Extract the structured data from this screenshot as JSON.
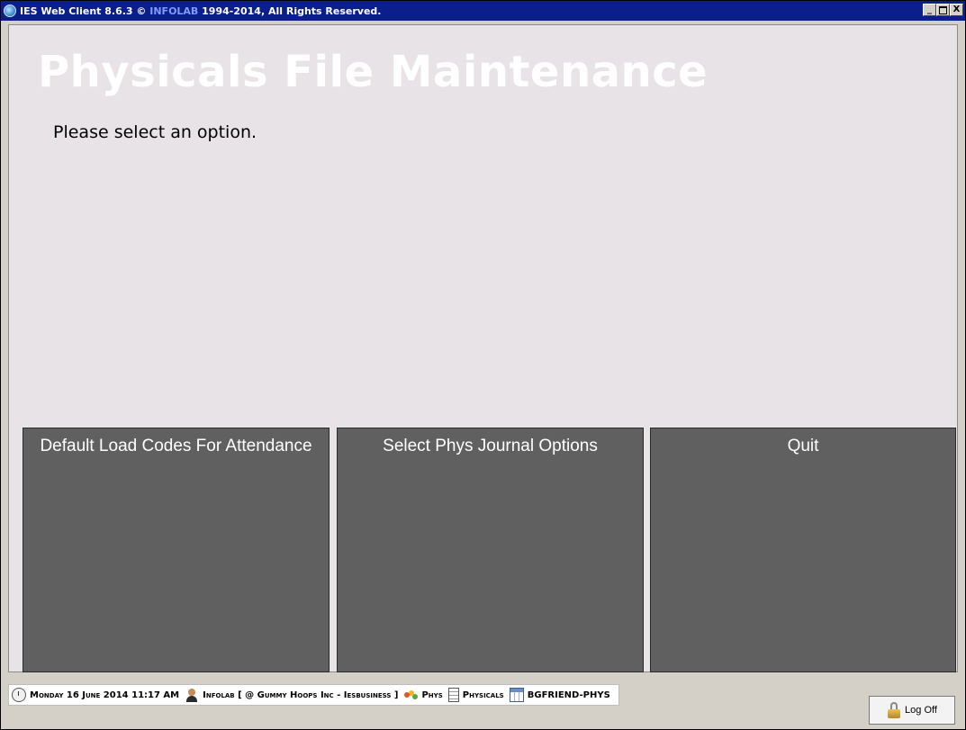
{
  "window": {
    "title_prefix": "IES Web Client 8.6.3 © ",
    "title_brand": "INFOLAB",
    "title_suffix": " 1994-2014, All Rights Reserved.",
    "controls": {
      "minimize": "_",
      "restore": " ",
      "close": "X"
    }
  },
  "page": {
    "title": "Physicals File Maintenance",
    "prompt": "Please select an option."
  },
  "options": [
    {
      "label": "Default Load Codes For Attendance"
    },
    {
      "label": "Select Phys Journal Options"
    },
    {
      "label": "Quit"
    }
  ],
  "statusbar": {
    "datetime": "Monday 16 June 2014 11:17 AM",
    "user": "Infolab [ @ Gummy Hoops Inc - Iesbusiness ]",
    "module": "Phys",
    "screen": "Physicals",
    "program": "BGFRIEND-PHYS",
    "icons": [
      "clock-icon",
      "user-icon",
      "phys-icon",
      "document-icon",
      "table-icon"
    ]
  },
  "logoff": {
    "label": "Log Off",
    "icon": "padlock-icon"
  },
  "colors": {
    "titlebar": "#0a1e8c",
    "client_bg": "#e7e3e6",
    "option_bg": "#606060",
    "title_text": "#ffffff"
  }
}
